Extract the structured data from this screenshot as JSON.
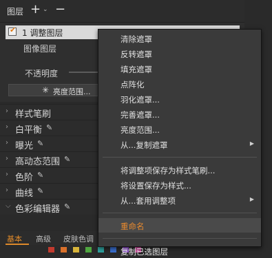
{
  "layers_panel": {
    "title": "图层",
    "layers": [
      {
        "name": "1 调整图层",
        "checked": true
      },
      {
        "name": "图像图层"
      }
    ],
    "opacity_label": "不透明度",
    "range_button": "亮度范围..."
  },
  "tools": [
    {
      "label": "样式笔刷",
      "brush": false
    },
    {
      "label": "白平衡",
      "brush": true
    },
    {
      "label": "曝光",
      "brush": true
    },
    {
      "label": "高动态范围",
      "brush": true
    },
    {
      "label": "色阶",
      "brush": true
    },
    {
      "label": "曲线",
      "brush": true
    },
    {
      "label": "色彩编辑器",
      "brush": true,
      "expanded": true
    }
  ],
  "tabs": [
    "基本",
    "高级",
    "皮肤色调"
  ],
  "active_tab": "基本",
  "swatch_colors": [
    "#c23a2e",
    "#d9702a",
    "#d8b43a",
    "#4fa640",
    "#2fa3a0",
    "#3a6fd0",
    "#8a4ec9",
    "#c94a9b"
  ],
  "accent_color": "#e08a2a",
  "context_menu": {
    "groups": [
      [
        {
          "label": "清除遮罩"
        },
        {
          "label": "反转遮罩"
        },
        {
          "label": "填充遮罩"
        },
        {
          "label": "点阵化"
        },
        {
          "label": "羽化遮罩..."
        },
        {
          "label": "完善遮罩..."
        },
        {
          "label": "亮度范围..."
        },
        {
          "label": "从...复制遮罩",
          "submenu": true
        }
      ],
      [
        {
          "label": "将调整项保存为样式笔刷..."
        },
        {
          "label": "将设置保存为样式..."
        },
        {
          "label": "从...套用调整项",
          "submenu": true
        }
      ],
      [
        {
          "label": "重命名",
          "highlighted": true
        }
      ],
      [
        {
          "label": "复制已选图层"
        }
      ]
    ]
  }
}
